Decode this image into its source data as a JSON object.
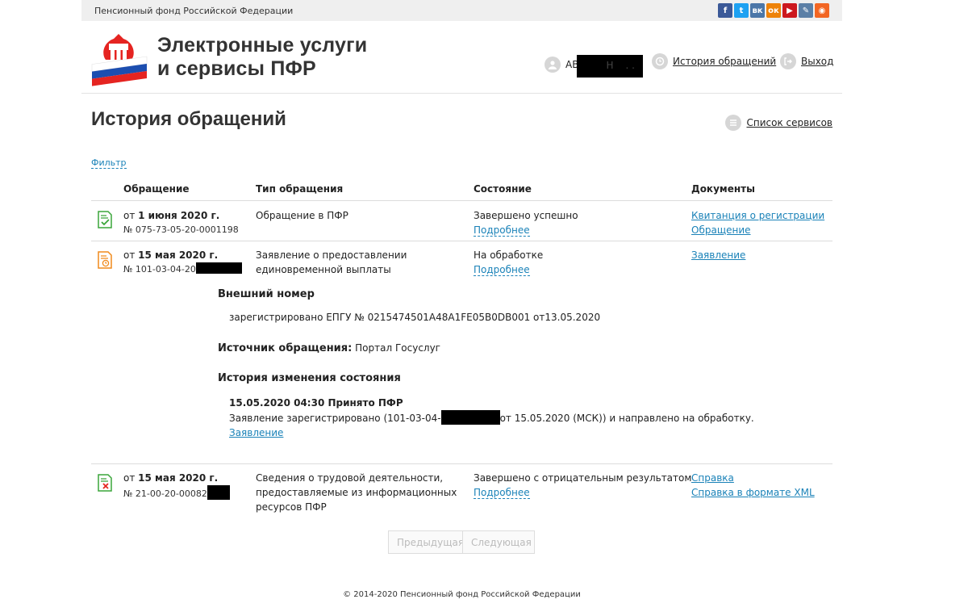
{
  "topbar": {
    "org": "Пенсионный фонд Российской Федерации",
    "social": [
      {
        "icon": "facebook-icon",
        "glyph": "f",
        "color": "#3b5998"
      },
      {
        "icon": "twitter-icon",
        "glyph": "t",
        "color": "#1da1f2"
      },
      {
        "icon": "vk-icon",
        "glyph": "вк",
        "color": "#4a76a8"
      },
      {
        "icon": "odnoklassniki-icon",
        "glyph": "ок",
        "color": "#ee8208"
      },
      {
        "icon": "youtube-icon",
        "glyph": "▶",
        "color": "#cc181e"
      },
      {
        "icon": "livejournal-icon",
        "glyph": "✎",
        "color": "#5b7fa6"
      },
      {
        "icon": "rss-icon",
        "glyph": "◉",
        "color": "#f26522"
      }
    ]
  },
  "header": {
    "brand_line1": "Электронные услуги",
    "brand_line2": "и сервисы ПФР",
    "user": {
      "prefix": "АВ",
      "mid": "Н",
      "dots": ". ."
    },
    "history_link": "История обращений",
    "logout_link": "Выход"
  },
  "page": {
    "title": "История обращений",
    "services_link": "Список сервисов",
    "filter": "Фильтр"
  },
  "table": {
    "headers": [
      "Обращение",
      "Тип обращения",
      "Состояние",
      "Документы"
    ],
    "rows": [
      {
        "date_prefix": "от ",
        "date": "1 июня 2020 г.",
        "number": "№ 075-73-05-20-0001198",
        "type": [
          "Обращение в ПФР"
        ],
        "status": "Завершено успешно",
        "details": "Подробнее",
        "docs": [
          "Квитанция о регистрации",
          "Обращение"
        ]
      },
      {
        "date_prefix": "от ",
        "date": "15 мая 2020 г.",
        "number": "№ 101-03-04-20",
        "type": [
          "Заявление о предоставлении",
          "единовременной выплаты"
        ],
        "status": "На обработке",
        "details": "Подробнее",
        "docs": [
          "Заявление"
        ]
      },
      {
        "date_prefix": "от ",
        "date": "15 мая 2020 г.",
        "number": "№ 21-00-20-00082",
        "type": [
          "Сведения о трудовой деятельности,",
          "предоставляемые из информационных",
          "ресурсов ПФР"
        ],
        "status": "Завершено с отрицательным результатом",
        "details": "Подробнее",
        "docs": [
          "Справка",
          "Справка в формате XML"
        ]
      }
    ]
  },
  "expanded": {
    "external_heading": "Внешний номер",
    "external_text": "зарегистрировано ЕПГУ № 0215474501A48A1FE05B0DB001 от13.05.2020",
    "source_label": "Источник обращения:",
    "source_value": " Портал Госуслуг",
    "history_heading": "История изменения состояния",
    "event_title": "15.05.2020 04:30 Принято ПФР",
    "event_text_a": "Заявление зарегистрировано (101-03-04-",
    "event_text_b": "от 15.05.2020 (МСК)) и направлено на обработку.",
    "event_link": "Заявление"
  },
  "pager": {
    "prev": "Предыдущая",
    "next": "Следующая"
  },
  "footer": "© 2014-2020 Пенсионный фонд Российской Федерации"
}
